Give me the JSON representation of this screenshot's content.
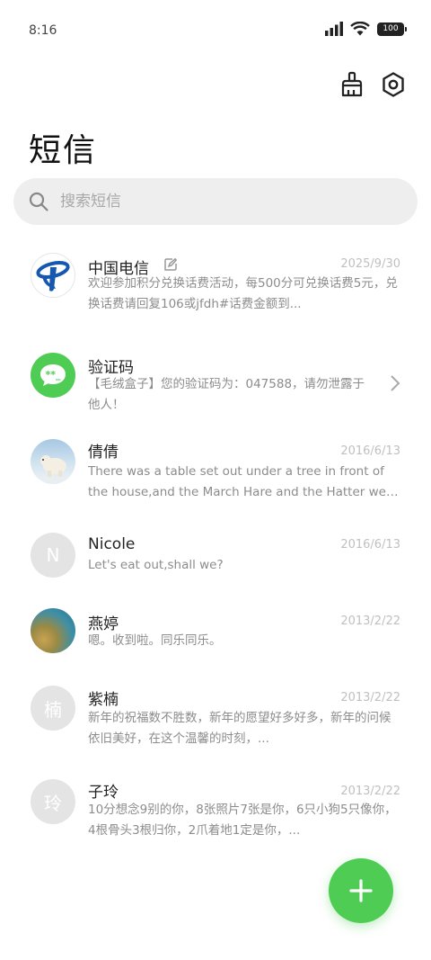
{
  "status_bar": {
    "time": "8:16",
    "battery": "100"
  },
  "page": {
    "title": "短信"
  },
  "search": {
    "placeholder": "搜索短信"
  },
  "conversations": [
    {
      "name": "中国电信",
      "date": "2025/9/30",
      "preview": "欢迎参加积分兑换话费活动，每500分可兑换话费5元，兑换话费请回复106或jfdh#话费金额到...",
      "avatar": "china-telecom-logo"
    },
    {
      "name": "验证码",
      "date": "",
      "preview": "【毛绒盒子】您的验证码为：047588，请勿泄露于他人！",
      "avatar": "verification-bubble"
    },
    {
      "name": "倩倩",
      "date": "2016/6/13",
      "preview": "There was a table set out under a tree in front of the house,and the March Hare and the Hatter were having ...",
      "avatar": "polar-bear-photo"
    },
    {
      "name": "Nicole",
      "date": "2016/6/13",
      "preview": "Let's eat out,shall we?",
      "avatar_letter": "N"
    },
    {
      "name": "燕婷",
      "date": "2013/2/22",
      "preview": "嗯。收到啦。同乐同乐。",
      "avatar": "landscape-photo"
    },
    {
      "name": "紫楠",
      "date": "2013/2/22",
      "preview": "新年的祝福数不胜数，新年的愿望好多好多，新年的问候依旧美好，在这个温馨的时刻，...",
      "avatar_letter": "楠"
    },
    {
      "name": "子玲",
      "date": "2013/2/22",
      "preview": "10分想念9别的你，8张照片7张是你，6只小狗5只像你，4根骨头3根归你，2爪着地1定是你，...",
      "avatar_letter": "玲"
    }
  ],
  "colors": {
    "accent": "#4fcc54",
    "search_bg": "#eeeeee",
    "date": "#c0c0c0",
    "preview": "#8c8c8c"
  }
}
